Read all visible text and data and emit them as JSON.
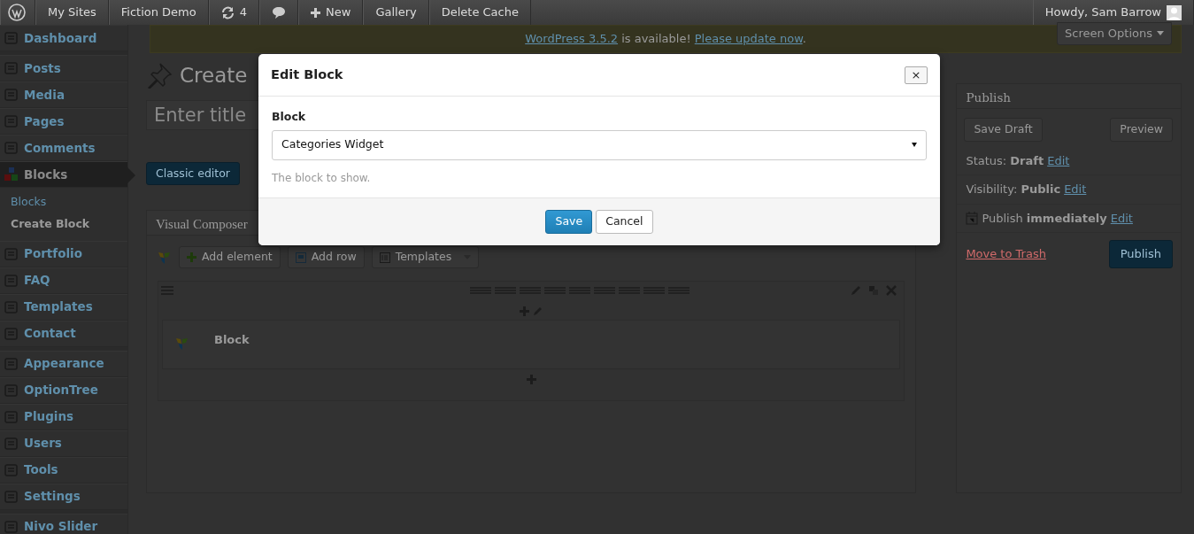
{
  "admin_bar": {
    "items": [
      {
        "kind": "logo"
      },
      {
        "kind": "text",
        "label": "My Sites"
      },
      {
        "kind": "text",
        "label": "Fiction Demo"
      },
      {
        "kind": "updates",
        "label": "4"
      },
      {
        "kind": "comments"
      },
      {
        "kind": "new",
        "label": "New"
      },
      {
        "kind": "text",
        "label": "Gallery"
      },
      {
        "kind": "text",
        "label": "Delete Cache"
      }
    ],
    "account": {
      "greeting": "Howdy, Sam Barrow"
    }
  },
  "sidebar": {
    "groups": [
      [
        {
          "label": "Dashboard",
          "selected": false
        }
      ],
      [
        {
          "label": "Posts",
          "selected": false
        },
        {
          "label": "Media",
          "selected": false
        },
        {
          "label": "Pages",
          "selected": false
        },
        {
          "label": "Comments",
          "selected": false
        },
        {
          "label": "Blocks",
          "selected": true,
          "children": [
            {
              "label": "Blocks",
              "selected": false
            },
            {
              "label": "Create Block",
              "selected": true
            }
          ]
        },
        {
          "label": "Portfolio",
          "selected": false
        },
        {
          "label": "FAQ",
          "selected": false
        },
        {
          "label": "Templates",
          "selected": false
        },
        {
          "label": "Contact",
          "selected": false
        }
      ],
      [
        {
          "label": "Appearance",
          "selected": false
        },
        {
          "label": "OptionTree",
          "selected": false
        },
        {
          "label": "Plugins",
          "selected": false
        },
        {
          "label": "Users",
          "selected": false
        },
        {
          "label": "Tools",
          "selected": false
        },
        {
          "label": "Settings",
          "selected": false
        }
      ],
      [
        {
          "label": "Nivo Slider",
          "selected": false
        }
      ]
    ]
  },
  "notice": {
    "version_link": "WordPress 3.5.2",
    "message": "is available!",
    "update_link": "Please update now",
    "end": "."
  },
  "screen_options": {
    "label": "Screen Options"
  },
  "page_title": "Create",
  "title_field": {
    "placeholder": "Enter title"
  },
  "classic_editor_button": "Classic editor",
  "visual_composer": {
    "title": "Visual Composer",
    "toolbar": [
      {
        "kind": "add",
        "label": "Add element"
      },
      {
        "kind": "row",
        "label": "Add row"
      },
      {
        "kind": "templates",
        "label": "Templates"
      }
    ],
    "element": {
      "label": "Block"
    }
  },
  "publish": {
    "title": "Publish",
    "save_draft": "Save Draft",
    "preview": "Preview",
    "rows": [
      {
        "kind": "plain",
        "label": "Status:",
        "value": "Draft",
        "action": "Edit"
      },
      {
        "kind": "plain",
        "label": "Visibility:",
        "value": "Public",
        "action": "Edit"
      },
      {
        "kind": "calendar",
        "label": "Publish",
        "value": "immediately",
        "action": "Edit"
      }
    ],
    "trash": "Move to Trash",
    "publish_button": "Publish"
  },
  "modal": {
    "title": "Edit Block",
    "close": "×",
    "field_label": "Block",
    "value": "Categories Widget",
    "help": "The block to show.",
    "buttons": [
      {
        "kind": "primary",
        "label": "Save"
      },
      {
        "kind": "secondary",
        "label": "Cancel"
      }
    ]
  }
}
